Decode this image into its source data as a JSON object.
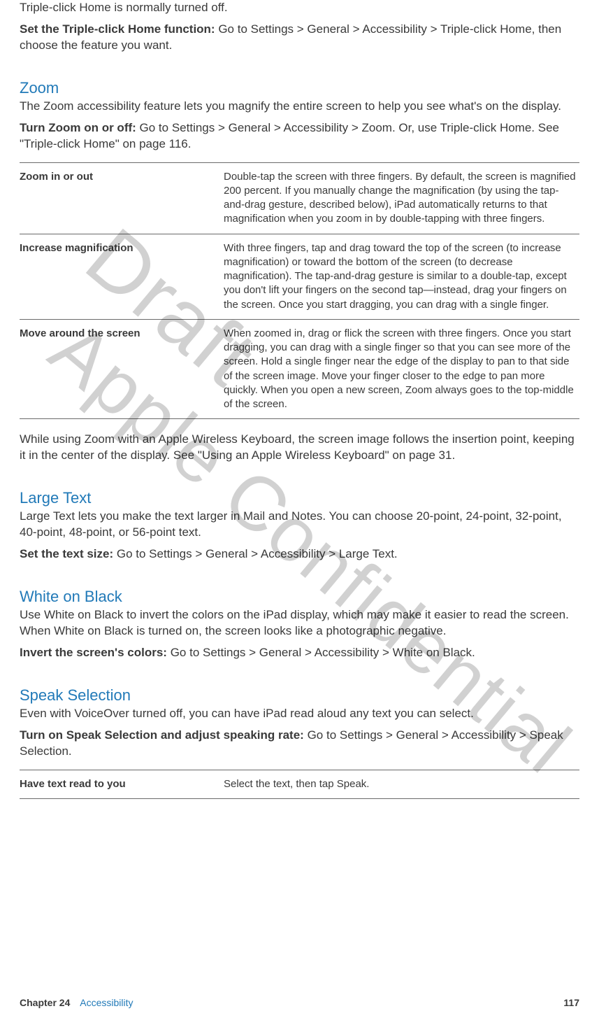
{
  "intro": {
    "line1": "Triple-click Home is normally turned off.",
    "set_lead": "Set the Triple-click Home function:",
    "set_body": "  Go to Settings > General > Accessibility > Triple-click Home, then choose the feature you want."
  },
  "zoom": {
    "heading": "Zoom",
    "desc": "The Zoom accessibility feature lets you magnify the entire screen to help you see what's on the display.",
    "turn_lead": "Turn Zoom on or off:",
    "turn_body": "  Go to Settings > General > Accessibility > Zoom. Or, use Triple-click Home. See \"Triple-click Home\" on page 116.",
    "table": [
      {
        "label": "Zoom in or out",
        "desc": "Double-tap the screen with three fingers. By default, the screen is magnified 200 percent. If you manually change the magnification (by using the tap-and-drag gesture, described below), iPad automatically returns to that magnification when you zoom in by double-tapping with three fingers."
      },
      {
        "label": "Increase magnification",
        "desc": "With three fingers, tap and drag toward the top of the screen (to increase magnification) or toward the bottom of the screen (to decrease magnification). The tap-and-drag gesture is similar to a double-tap, except you don't lift your fingers on the second tap—instead, drag your fingers on the screen. Once you start dragging, you can drag with a single finger."
      },
      {
        "label": "Move around the screen",
        "desc": "When zoomed in, drag or flick the screen with three fingers. Once you start dragging, you can drag with a single finger so that you can see more of the screen. Hold a single finger near the edge of the display to pan to that side of the screen image. Move your finger closer to the edge to pan more quickly. When you open a new screen, Zoom always goes to the top-middle of the screen."
      }
    ],
    "after": "While using Zoom with an Apple Wireless Keyboard, the screen image follows the insertion point, keeping it in the center of the display. See \"Using an Apple Wireless Keyboard\" on page 31."
  },
  "large_text": {
    "heading": "Large Text",
    "desc": "Large Text lets you make the text larger in Mail and Notes. You can choose 20-point, 24-point, 32-point, 40-point, 48-point, or 56-point text.",
    "set_lead": "Set the text size:",
    "set_body": "  Go to Settings > General > Accessibility > Large Text."
  },
  "white_on_black": {
    "heading": "White on Black",
    "desc": "Use White on Black to invert the colors on the iPad display, which may make it easier to read the screen. When White on Black is turned on, the screen looks like a photographic negative.",
    "set_lead": "Invert the screen's colors:",
    "set_body": "  Go to Settings > General > Accessibility > White on Black."
  },
  "speak_selection": {
    "heading": "Speak Selection",
    "desc": "Even with VoiceOver turned off, you can have iPad read aloud any text you can select.",
    "set_lead": "Turn on Speak Selection and adjust speaking rate:",
    "set_body": "  Go to Settings > General > Accessibility > Speak Selection.",
    "table": [
      {
        "label": "Have text read to you",
        "desc": "Select the text, then tap Speak."
      }
    ]
  },
  "footer": {
    "chapter_label": "Chapter 24",
    "chapter_name": "Accessibility",
    "page_number": "117"
  },
  "watermarks": {
    "draft": "Draft",
    "confidential": "Apple Confidential"
  }
}
